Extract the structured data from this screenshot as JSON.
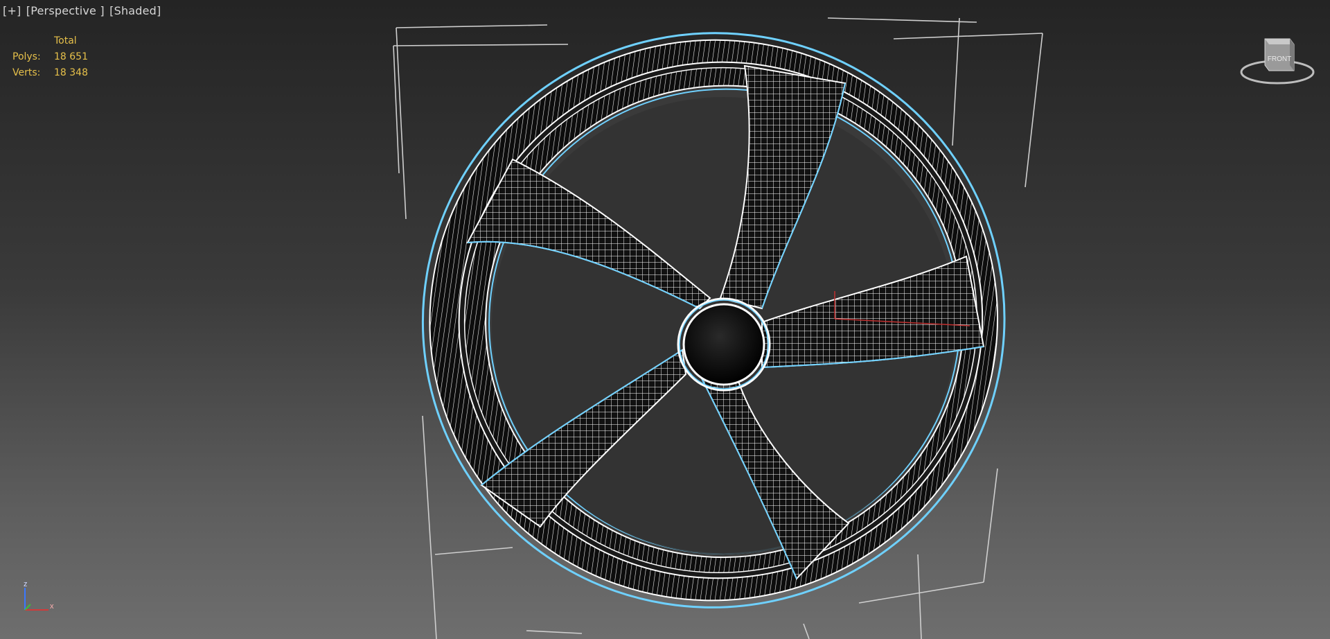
{
  "viewport": {
    "menu": {
      "plus": "[+]",
      "view": "[Perspective ]",
      "shading": "[Shaded]"
    },
    "stats": {
      "header": "Total",
      "polys_label": "Polys:",
      "polys_value": "18 651",
      "verts_label": "Verts:",
      "verts_value": "18 348"
    },
    "viewcube": {
      "face_label": "FRONT"
    },
    "axis": {
      "z": "z",
      "x": "x"
    }
  },
  "colors": {
    "wire": "#ffffff",
    "selection_outline": "#6fd1ff",
    "stats_text": "#e6c04a",
    "axis_x": "#d23a3a",
    "axis_z": "#3a78ff"
  }
}
